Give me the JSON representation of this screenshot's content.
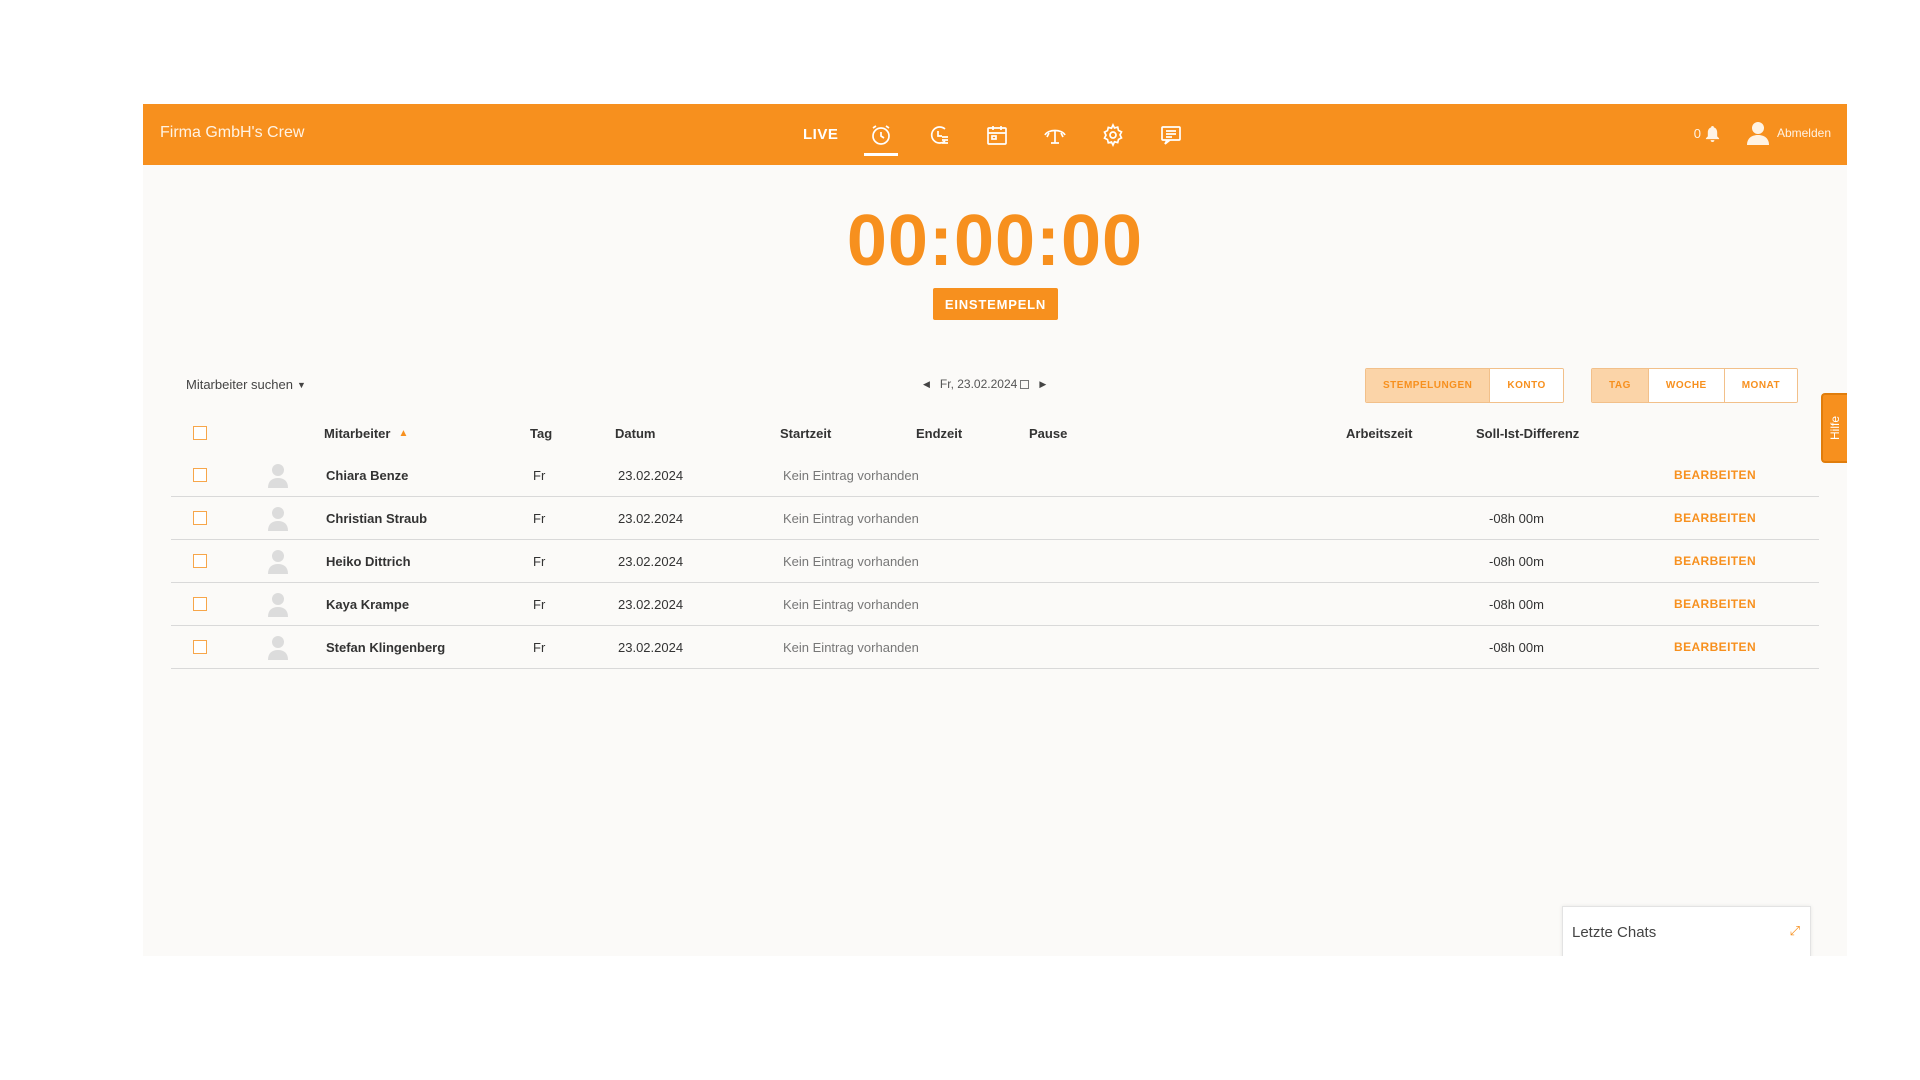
{
  "header": {
    "brand": "Firma GmbH's Crew",
    "live_label": "LIVE",
    "nav_icons": [
      "alarm-clock-icon",
      "timeline-clock-icon",
      "calendar-icon",
      "absence-icon",
      "settings-icon",
      "messages-icon"
    ],
    "notification_count": "0",
    "logout_label": "Abmelden"
  },
  "timer": {
    "value": "00:00:00",
    "clock_in_label": "EINSTEMPELN"
  },
  "controls": {
    "employee_search_label": "Mitarbeiter suchen",
    "current_date": "Fr, 23.02.2024",
    "mode_tabs": [
      {
        "label": "STEMPELUNGEN",
        "active": true
      },
      {
        "label": "KONTO",
        "active": false
      }
    ],
    "period_tabs": [
      {
        "label": "TAG",
        "active": true
      },
      {
        "label": "WOCHE",
        "active": false
      },
      {
        "label": "MONAT",
        "active": false
      }
    ],
    "help_label": "Hilfe"
  },
  "table": {
    "columns": {
      "employee": "Mitarbeiter",
      "day": "Tag",
      "date": "Datum",
      "start": "Startzeit",
      "end": "Endzeit",
      "pause": "Pause",
      "worktime": "Arbeitszeit",
      "diff": "Soll-Ist-Differenz"
    },
    "rows": [
      {
        "name": "Chiara Benze",
        "day": "Fr",
        "date": "23.02.2024",
        "start": "Kein Eintrag vorhanden",
        "diff": "",
        "action": "BEARBEITEN"
      },
      {
        "name": "Christian Straub",
        "day": "Fr",
        "date": "23.02.2024",
        "start": "Kein Eintrag vorhanden",
        "diff": "-08h 00m",
        "action": "BEARBEITEN"
      },
      {
        "name": "Heiko Dittrich",
        "day": "Fr",
        "date": "23.02.2024",
        "start": "Kein Eintrag vorhanden",
        "diff": "-08h 00m",
        "action": "BEARBEITEN"
      },
      {
        "name": "Kaya Krampe",
        "day": "Fr",
        "date": "23.02.2024",
        "start": "Kein Eintrag vorhanden",
        "diff": "-08h 00m",
        "action": "BEARBEITEN"
      },
      {
        "name": "Stefan Klingenberg",
        "day": "Fr",
        "date": "23.02.2024",
        "start": "Kein Eintrag vorhanden",
        "diff": "-08h 00m",
        "action": "BEARBEITEN"
      }
    ]
  },
  "chats": {
    "title": "Letzte Chats"
  },
  "colors": {
    "accent": "#f7901e",
    "background": "#fbfaf8"
  }
}
